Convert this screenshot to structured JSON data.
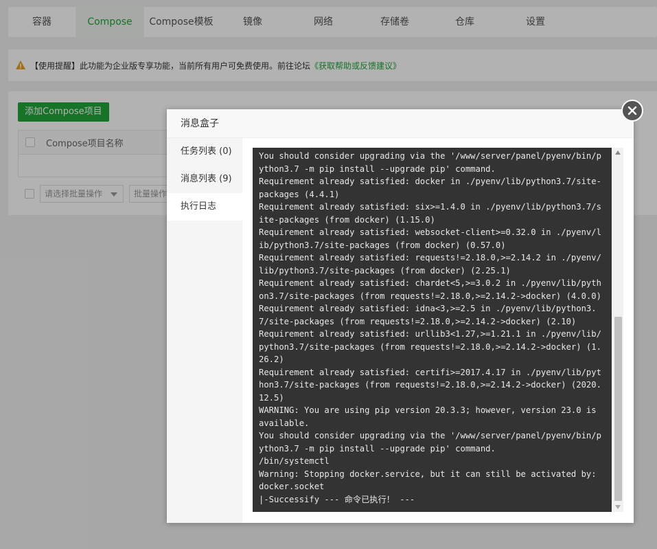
{
  "tabs": [
    "容器",
    "Compose",
    "Compose模板",
    "镜像",
    "网络",
    "存储卷",
    "仓库",
    "设置"
  ],
  "active_tab": "Compose",
  "notice": {
    "text": "【使用提醒】此功能为企业版专享功能，当前所有用户可免费使用。前往论坛",
    "link": "《获取帮助或反馈建议》"
  },
  "compose": {
    "add_button": "添加Compose项目",
    "column_name": "Compose项目名称",
    "batch_select_placeholder": "请选择批量操作",
    "batch_button": "批量操作"
  },
  "dialog": {
    "title": "消息盒子",
    "side_items": [
      "任务列表 (0)",
      "消息列表 (9)",
      "执行日志"
    ],
    "active_item": "执行日志",
    "log_lines": [
      "You should consider upgrading via the '/www/server/panel/pyenv/bin/python3.7 -m pip install --upgrade pip' command.",
      "Requirement already satisfied: docker in ./pyenv/lib/python3.7/site-packages (4.4.1)",
      "Requirement already satisfied: six>=1.4.0 in ./pyenv/lib/python3.7/site-packages (from docker) (1.15.0)",
      "Requirement already satisfied: websocket-client>=0.32.0 in ./pyenv/lib/python3.7/site-packages (from docker) (0.57.0)",
      "Requirement already satisfied: requests!=2.18.0,>=2.14.2 in ./pyenv/lib/python3.7/site-packages (from docker) (2.25.1)",
      "Requirement already satisfied: chardet<5,>=3.0.2 in ./pyenv/lib/python3.7/site-packages (from requests!=2.18.0,>=2.14.2->docker) (4.0.0)",
      "Requirement already satisfied: idna<3,>=2.5 in ./pyenv/lib/python3.7/site-packages (from requests!=2.18.0,>=2.14.2->docker) (2.10)",
      "Requirement already satisfied: urllib3<1.27,>=1.21.1 in ./pyenv/lib/python3.7/site-packages (from requests!=2.18.0,>=2.14.2->docker) (1.26.2)",
      "Requirement already satisfied: certifi>=2017.4.17 in ./pyenv/lib/python3.7/site-packages (from requests!=2.18.0,>=2.14.2->docker) (2020.12.5)",
      "WARNING: You are using pip version 20.3.3; however, version 23.0 is available.",
      "You should consider upgrading via the '/www/server/panel/pyenv/bin/python3.7 -m pip install --upgrade pip' command.",
      "/bin/systemctl",
      "Warning: Stopping docker.service, but it can still be activated by:",
      "docker.socket",
      "|-Successify --- 命令已执行！ ---"
    ]
  },
  "colors": {
    "accent": "#20a53a",
    "console_bg": "#333333",
    "console_text": "#e8e8e8",
    "close_bg": "#555555"
  }
}
